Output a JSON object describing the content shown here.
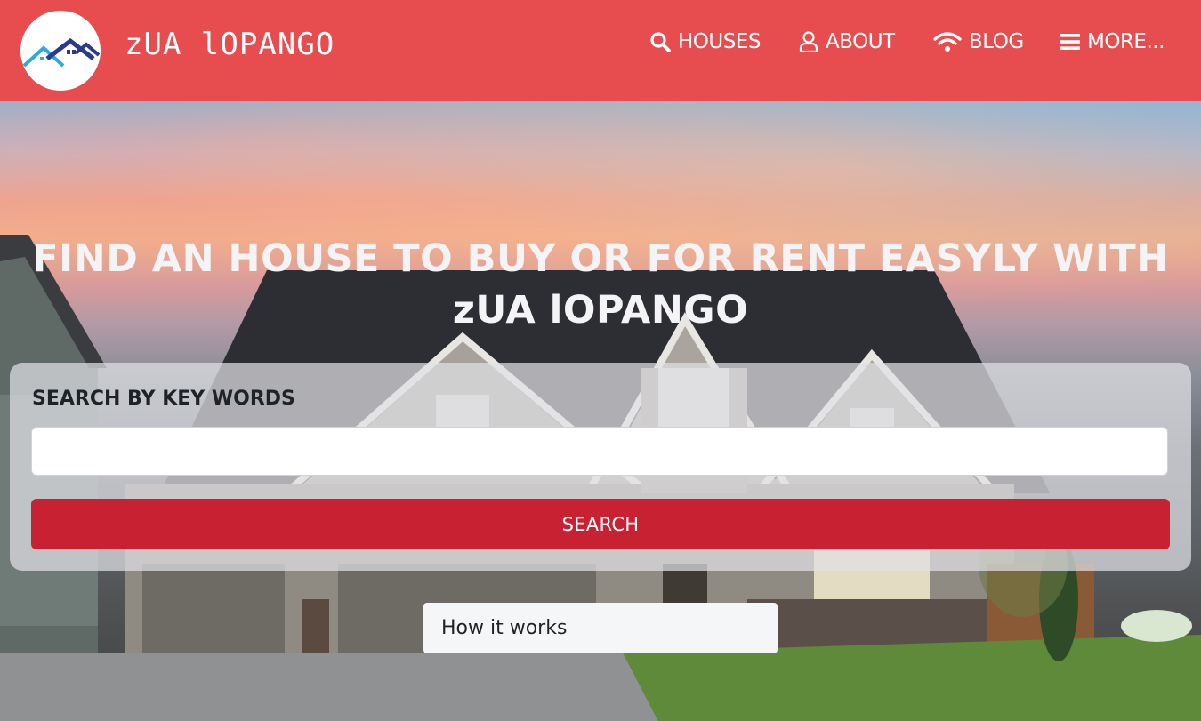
{
  "brand": {
    "name": "zUA lOPANGO",
    "logo": "house-roofs-logo"
  },
  "nav": {
    "items": [
      {
        "label": "HOUSES",
        "icon": "search-icon"
      },
      {
        "label": "ABOUT",
        "icon": "user-icon"
      },
      {
        "label": "BLOG",
        "icon": "wifi-icon"
      },
      {
        "label": "MORE...",
        "icon": "menu-icon"
      }
    ]
  },
  "hero": {
    "headline_line1": "FIND AN HOUSE TO BUY OR FOR RENT EASYLY WITH",
    "headline_line2": "zUA lOPANGO"
  },
  "search": {
    "label": "SEARCH BY KEY WORDS",
    "input_value": "",
    "placeholder": "",
    "button_label": "SEARCH"
  },
  "how_it_works": {
    "label": "How it works"
  },
  "colors": {
    "navbar": "#e74c4f",
    "search_button": "#c82131",
    "logo_roof_light": "#2fa8e0",
    "logo_roof_dark": "#2b3a8f"
  }
}
